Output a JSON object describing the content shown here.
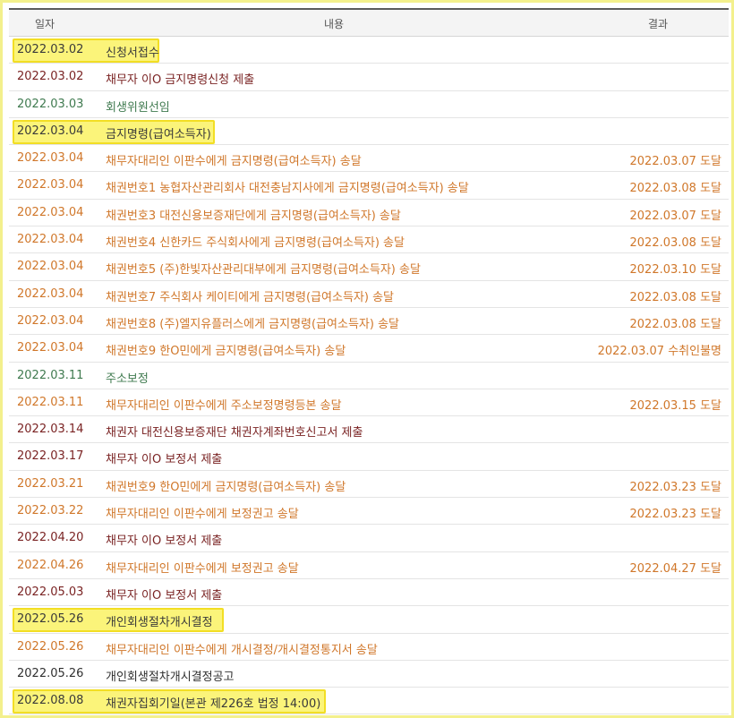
{
  "header": {
    "date": "일자",
    "content": "내용",
    "result": "결과"
  },
  "colors": {
    "orange": "#d0772a",
    "green": "#3f7a4f",
    "maroon": "#7a2323",
    "dark": "#2f2f2f",
    "highlight": "#fbf47a"
  },
  "rows": [
    {
      "date": "2022.03.02",
      "content": "신청서접수",
      "result": "",
      "color": "dark",
      "highlight": true
    },
    {
      "date": "2022.03.02",
      "content": "채무자 이O 금지명령신청 제출",
      "result": "",
      "color": "maroon",
      "highlight": false
    },
    {
      "date": "2022.03.03",
      "content": "회생위원선임",
      "result": "",
      "color": "green",
      "highlight": false
    },
    {
      "date": "2022.03.04",
      "content": "금지명령(급여소득자)",
      "result": "",
      "color": "dark",
      "highlight": true
    },
    {
      "date": "2022.03.04",
      "content": "채무자대리인 이판수에게 금지명령(급여소득자) 송달",
      "result": "2022.03.07 도달",
      "color": "orange",
      "highlight": false
    },
    {
      "date": "2022.03.04",
      "content": "채권번호1 농협자산관리회사 대전충남지사에게 금지명령(급여소득자) 송달",
      "result": "2022.03.08 도달",
      "color": "orange",
      "highlight": false
    },
    {
      "date": "2022.03.04",
      "content": "채권번호3 대전신용보증재단에게 금지명령(급여소득자) 송달",
      "result": "2022.03.07 도달",
      "color": "orange",
      "highlight": false
    },
    {
      "date": "2022.03.04",
      "content": "채권번호4 신한카드 주식회사에게 금지명령(급여소득자) 송달",
      "result": "2022.03.08 도달",
      "color": "orange",
      "highlight": false
    },
    {
      "date": "2022.03.04",
      "content": "채권번호5 (주)한빛자산관리대부에게 금지명령(급여소득자) 송달",
      "result": "2022.03.10 도달",
      "color": "orange",
      "highlight": false
    },
    {
      "date": "2022.03.04",
      "content": "채권번호7 주식회사 케이티에게 금지명령(급여소득자) 송달",
      "result": "2022.03.08 도달",
      "color": "orange",
      "highlight": false
    },
    {
      "date": "2022.03.04",
      "content": "채권번호8 (주)엘지유플러스에게 금지명령(급여소득자) 송달",
      "result": "2022.03.08 도달",
      "color": "orange",
      "highlight": false
    },
    {
      "date": "2022.03.04",
      "content": "채권번호9 한O민에게 금지명령(급여소득자) 송달",
      "result": "2022.03.07 수취인불명",
      "color": "orange",
      "highlight": false
    },
    {
      "date": "2022.03.11",
      "content": "주소보정",
      "result": "",
      "color": "green",
      "highlight": false
    },
    {
      "date": "2022.03.11",
      "content": "채무자대리인 이판수에게 주소보정명령등본 송달",
      "result": "2022.03.15 도달",
      "color": "orange",
      "highlight": false
    },
    {
      "date": "2022.03.14",
      "content": "채권자 대전신용보증재단 채권자계좌번호신고서 제출",
      "result": "",
      "color": "maroon",
      "highlight": false
    },
    {
      "date": "2022.03.17",
      "content": "채무자 이O 보정서 제출",
      "result": "",
      "color": "maroon",
      "highlight": false
    },
    {
      "date": "2022.03.21",
      "content": "채권번호9 한O민에게 금지명령(급여소득자) 송달",
      "result": "2022.03.23 도달",
      "color": "orange",
      "highlight": false
    },
    {
      "date": "2022.03.22",
      "content": "채무자대리인 이판수에게 보정권고 송달",
      "result": "2022.03.23 도달",
      "color": "orange",
      "highlight": false
    },
    {
      "date": "2022.04.20",
      "content": "채무자 이O 보정서 제출",
      "result": "",
      "color": "maroon",
      "highlight": false
    },
    {
      "date": "2022.04.26",
      "content": "채무자대리인 이판수에게 보정권고 송달",
      "result": "2022.04.27 도달",
      "color": "orange",
      "highlight": false
    },
    {
      "date": "2022.05.03",
      "content": "채무자 이O 보정서 제출",
      "result": "",
      "color": "maroon",
      "highlight": false
    },
    {
      "date": "2022.05.26",
      "content": "개인회생절차개시결정",
      "result": "",
      "color": "dark",
      "highlight": true
    },
    {
      "date": "2022.05.26",
      "content": "채무자대리인 이판수에게 개시결정/개시결정통지서 송달",
      "result": "",
      "color": "orange",
      "highlight": false
    },
    {
      "date": "2022.05.26",
      "content": "개인회생절차개시결정공고",
      "result": "",
      "color": "dark",
      "highlight": false
    },
    {
      "date": "2022.08.08",
      "content": "채권자집회기일(본관 제226호 법정 14:00)",
      "result": "",
      "color": "dark",
      "highlight": true
    }
  ]
}
